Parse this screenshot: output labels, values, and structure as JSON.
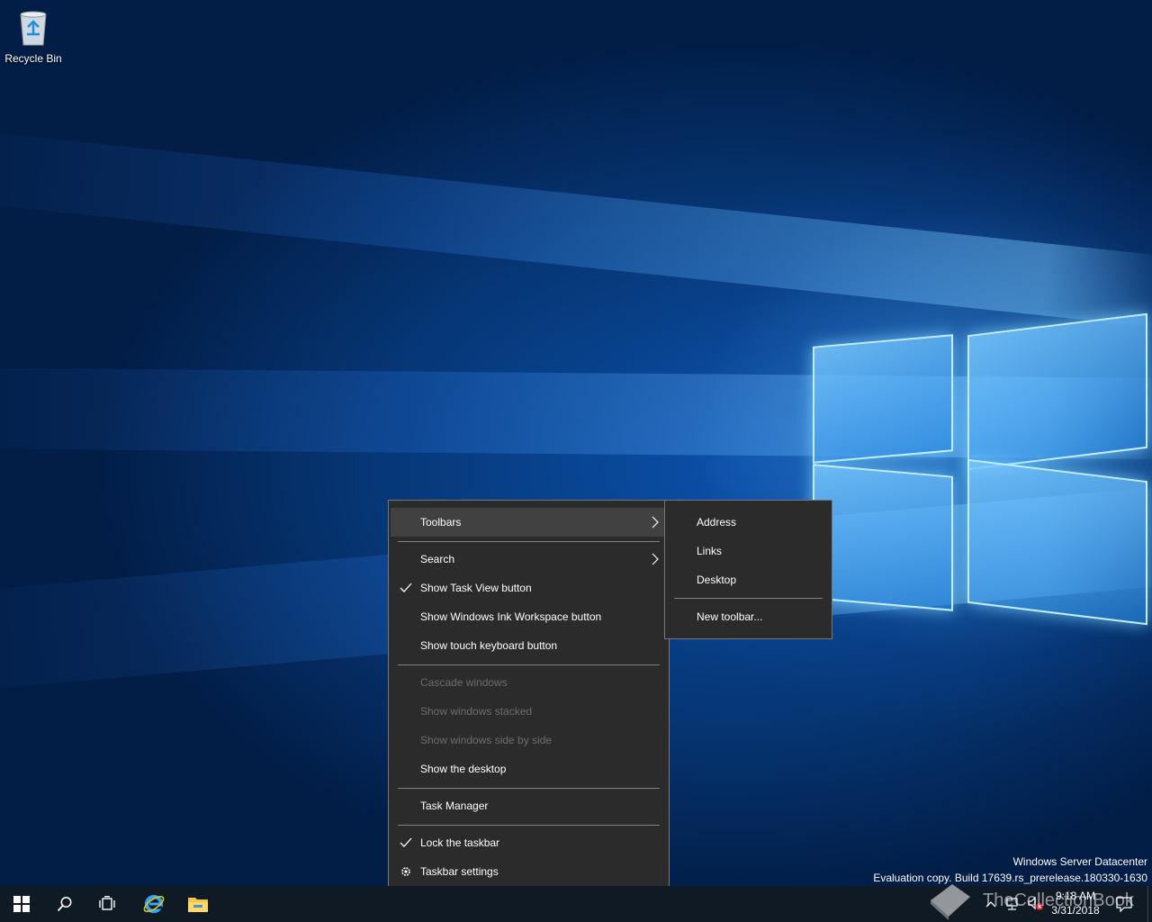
{
  "desktop": {
    "recycle_bin_label": "Recycle Bin",
    "watermark": {
      "line1": "Windows Server Datacenter",
      "line2": "Evaluation copy. Build 17639.rs_prerelease.180330-1630"
    },
    "overlay_watermark": "TheCollectionBook"
  },
  "context_menu": {
    "items": [
      {
        "label": "Toolbars",
        "checked": false,
        "submenu": true,
        "enabled": true,
        "highlighted": true
      },
      {
        "label": "Search",
        "checked": false,
        "submenu": true,
        "enabled": true
      },
      {
        "label": "Show Task View button",
        "checked": true,
        "submenu": false,
        "enabled": true
      },
      {
        "label": "Show Windows Ink Workspace button",
        "checked": false,
        "submenu": false,
        "enabled": true
      },
      {
        "label": "Show touch keyboard button",
        "checked": false,
        "submenu": false,
        "enabled": true
      },
      {
        "label": "Cascade windows",
        "checked": false,
        "submenu": false,
        "enabled": false
      },
      {
        "label": "Show windows stacked",
        "checked": false,
        "submenu": false,
        "enabled": false
      },
      {
        "label": "Show windows side by side",
        "checked": false,
        "submenu": false,
        "enabled": false
      },
      {
        "label": "Show the desktop",
        "checked": false,
        "submenu": false,
        "enabled": true
      },
      {
        "label": "Task Manager",
        "checked": false,
        "submenu": false,
        "enabled": true
      },
      {
        "label": "Lock the taskbar",
        "checked": true,
        "submenu": false,
        "enabled": true
      },
      {
        "label": "Taskbar settings",
        "icon": "gear-icon",
        "submenu": false,
        "enabled": true
      }
    ]
  },
  "toolbars_submenu": {
    "items": [
      {
        "label": "Address"
      },
      {
        "label": "Links"
      },
      {
        "label": "Desktop"
      },
      {
        "label": "New toolbar..."
      }
    ]
  },
  "taskbar": {
    "pinned": [
      "start-icon",
      "search-icon",
      "task-view-icon",
      "internet-explorer-icon",
      "file-explorer-icon"
    ],
    "clock": {
      "time": "9:18 AM",
      "date": "3/31/2018"
    },
    "colors": {
      "taskbar_bg": "#101a24",
      "menu_bg": "#2b2b2b",
      "accent": "#0078d7"
    }
  }
}
